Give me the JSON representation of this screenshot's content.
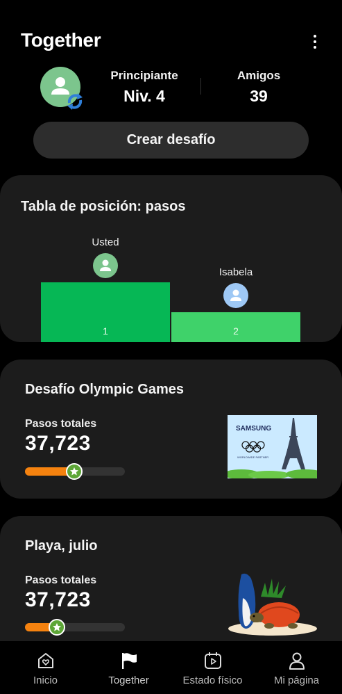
{
  "header": {
    "title": "Together",
    "level": {
      "label": "Principiante",
      "value": "Niv. 4"
    },
    "friends": {
      "label": "Amigos",
      "value": "39"
    },
    "create_button": "Crear desafío"
  },
  "leaderboard": {
    "title": "Tabla de posición: pasos",
    "entries": [
      {
        "name": "Usted",
        "rank": "1",
        "color": "#06b755"
      },
      {
        "name": "Isabela",
        "rank": "2",
        "color": "#3fd26a"
      }
    ]
  },
  "challenges": [
    {
      "title": "Desafío Olympic Games",
      "metric_label": "Pasos totales",
      "metric_value": "37,723",
      "progress": 0.49,
      "image": "samsung-olympics-paris-eiffel",
      "image_text": {
        "brand": "SAMSUNG",
        "partner": "WORLDWIDE PARTNER"
      }
    },
    {
      "title": "Playa, julio",
      "metric_label": "Pasos totales",
      "metric_value": "37,723",
      "progress": 0.32,
      "image": "beach-turtle-surfboard"
    }
  ],
  "bottom_nav": [
    {
      "label": "Inicio",
      "icon": "home-heart-icon"
    },
    {
      "label": "Together",
      "icon": "flag-icon",
      "active": true
    },
    {
      "label": "Estado físico",
      "icon": "calendar-play-icon"
    },
    {
      "label": "Mi página",
      "icon": "person-icon"
    }
  ],
  "colors": {
    "background": "#000000",
    "card": "#1c1c1c",
    "accent_green": "#06b755",
    "progress_orange": "#f5820f"
  }
}
